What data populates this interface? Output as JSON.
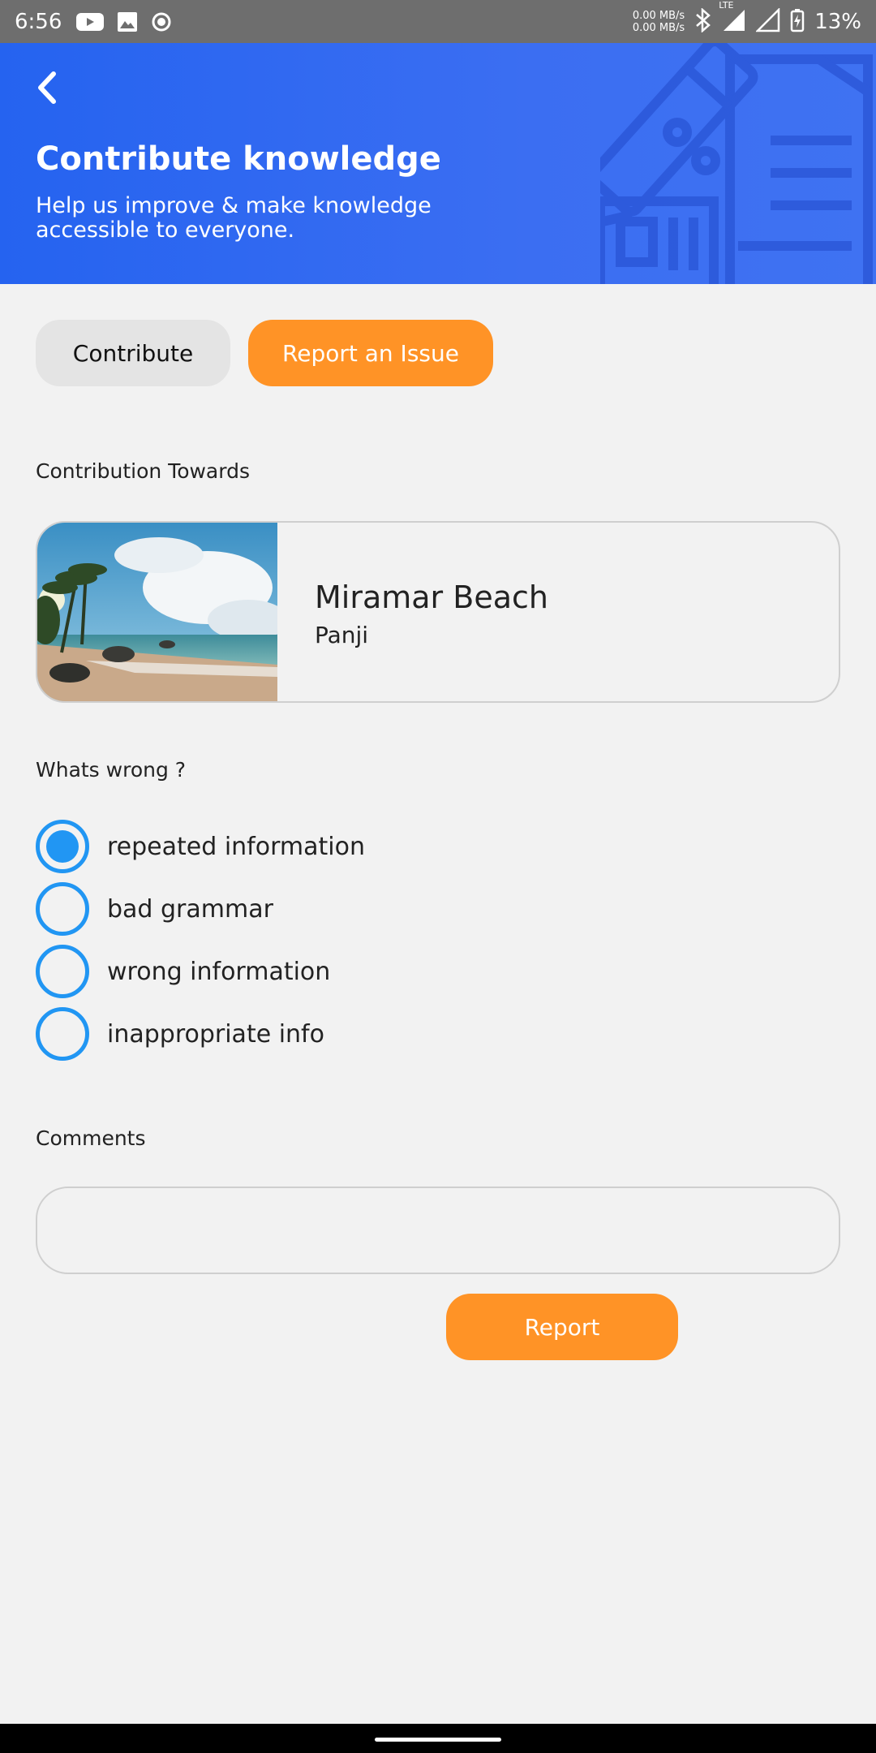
{
  "status_bar": {
    "time": "6:56",
    "net_up": "0.00 MB/s",
    "net_down": "0.00 MB/s",
    "network_type": "LTE",
    "battery": "13%"
  },
  "header": {
    "title": "Contribute knowledge",
    "subtitle": "Help us improve & make knowledge accessible to everyone."
  },
  "tabs": {
    "contribute": "Contribute",
    "report": "Report an Issue",
    "active": "report"
  },
  "contribution": {
    "label": "Contribution Towards",
    "place": "Miramar Beach",
    "location": "Panji"
  },
  "issue": {
    "label": "Whats wrong ?",
    "options": [
      {
        "label": "repeated information",
        "checked": true
      },
      {
        "label": "bad grammar",
        "checked": false
      },
      {
        "label": "wrong information",
        "checked": false
      },
      {
        "label": "inappropriate info",
        "checked": false
      }
    ]
  },
  "comments": {
    "label": "Comments",
    "value": "",
    "placeholder": ""
  },
  "report_button": "Report",
  "colors": {
    "primary_blue": "#2563f0",
    "accent_orange": "#ff9326",
    "radio_blue": "#2196f3"
  }
}
